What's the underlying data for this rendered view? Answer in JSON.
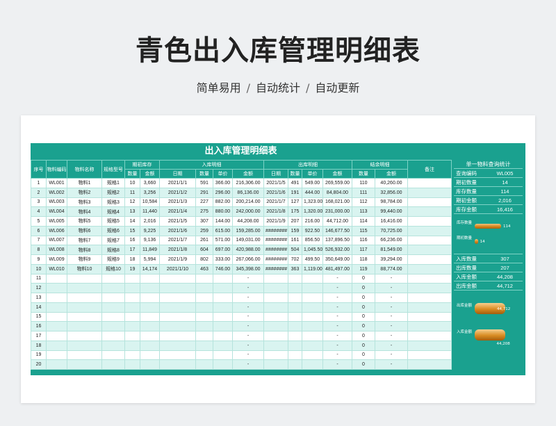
{
  "header": {
    "title": "青色出入库管理明细表",
    "subtitle_parts": [
      "简单易用",
      "自动统计",
      "自动更新"
    ],
    "sep": "/"
  },
  "sheet": {
    "title": "出入库管理明细表",
    "col_headers": {
      "no": "序号",
      "code": "物料编码",
      "name": "物料名称",
      "spec": "规格型号",
      "opening": "期初库存",
      "inbound": "入库明细",
      "outbound": "出库明细",
      "closing": "结余明细",
      "remark": "备注",
      "qty": "数量",
      "amount": "金额",
      "date": "日期",
      "price": "单价"
    },
    "rows": [
      {
        "no": "1",
        "code": "WL001",
        "name": "物料1",
        "spec": "规格1",
        "o_qty": "10",
        "o_amt": "3,660",
        "i_date": "2021/1/1",
        "i_qty": "591",
        "i_price": "366.00",
        "i_amt": "216,306.00",
        "x_date": "2021/1/5",
        "x_qty": "491",
        "x_price": "549.00",
        "x_amt": "269,559.00",
        "c_qty": "110",
        "c_amt": "40,260.00"
      },
      {
        "no": "2",
        "code": "WL002",
        "name": "物料2",
        "spec": "规格2",
        "o_qty": "11",
        "o_amt": "3,256",
        "i_date": "2021/1/2",
        "i_qty": "291",
        "i_price": "296.00",
        "i_amt": "86,136.00",
        "x_date": "2021/1/6",
        "x_qty": "191",
        "x_price": "444.00",
        "x_amt": "84,804.00",
        "c_qty": "111",
        "c_amt": "32,856.00"
      },
      {
        "no": "3",
        "code": "WL003",
        "name": "物料3",
        "spec": "规格3",
        "o_qty": "12",
        "o_amt": "10,584",
        "i_date": "2021/1/3",
        "i_qty": "227",
        "i_price": "882.00",
        "i_amt": "200,214.00",
        "x_date": "2021/1/7",
        "x_qty": "127",
        "x_price": "1,323.00",
        "x_amt": "168,021.00",
        "c_qty": "112",
        "c_amt": "98,784.00"
      },
      {
        "no": "4",
        "code": "WL004",
        "name": "物料4",
        "spec": "规格4",
        "o_qty": "13",
        "o_amt": "11,440",
        "i_date": "2021/1/4",
        "i_qty": "275",
        "i_price": "880.00",
        "i_amt": "242,000.00",
        "x_date": "2021/1/8",
        "x_qty": "175",
        "x_price": "1,320.00",
        "x_amt": "231,000.00",
        "c_qty": "113",
        "c_amt": "99,440.00"
      },
      {
        "no": "5",
        "code": "WL005",
        "name": "物料5",
        "spec": "规格5",
        "o_qty": "14",
        "o_amt": "2,016",
        "i_date": "2021/1/5",
        "i_qty": "307",
        "i_price": "144.00",
        "i_amt": "44,208.00",
        "x_date": "2021/1/9",
        "x_qty": "207",
        "x_price": "216.00",
        "x_amt": "44,712.00",
        "c_qty": "114",
        "c_amt": "16,416.00"
      },
      {
        "no": "6",
        "code": "WL006",
        "name": "物料6",
        "spec": "规格6",
        "o_qty": "15",
        "o_amt": "9,225",
        "i_date": "2021/1/6",
        "i_qty": "259",
        "i_price": "615.00",
        "i_amt": "159,285.00",
        "x_date": "########",
        "x_qty": "159",
        "x_price": "922.50",
        "x_amt": "146,677.50",
        "c_qty": "115",
        "c_amt": "70,725.00"
      },
      {
        "no": "7",
        "code": "WL007",
        "name": "物料7",
        "spec": "规格7",
        "o_qty": "16",
        "o_amt": "9,136",
        "i_date": "2021/1/7",
        "i_qty": "261",
        "i_price": "571.00",
        "i_amt": "149,031.00",
        "x_date": "########",
        "x_qty": "161",
        "x_price": "856.50",
        "x_amt": "137,896.50",
        "c_qty": "116",
        "c_amt": "66,236.00"
      },
      {
        "no": "8",
        "code": "WL008",
        "name": "物料8",
        "spec": "规格8",
        "o_qty": "17",
        "o_amt": "11,849",
        "i_date": "2021/1/8",
        "i_qty": "604",
        "i_price": "697.00",
        "i_amt": "420,988.00",
        "x_date": "########",
        "x_qty": "504",
        "x_price": "1,045.50",
        "x_amt": "526,932.00",
        "c_qty": "117",
        "c_amt": "81,549.00"
      },
      {
        "no": "9",
        "code": "WL009",
        "name": "物料9",
        "spec": "规格9",
        "o_qty": "18",
        "o_amt": "5,994",
        "i_date": "2021/1/9",
        "i_qty": "802",
        "i_price": "333.00",
        "i_amt": "267,066.00",
        "x_date": "########",
        "x_qty": "702",
        "x_price": "499.50",
        "x_amt": "350,649.00",
        "c_qty": "118",
        "c_amt": "39,294.00"
      },
      {
        "no": "10",
        "code": "WL010",
        "name": "物料10",
        "spec": "规格10",
        "o_qty": "19",
        "o_amt": "14,174",
        "i_date": "2021/1/10",
        "i_qty": "463",
        "i_price": "746.00",
        "i_amt": "345,398.00",
        "x_date": "########",
        "x_qty": "363",
        "x_price": "1,119.00",
        "x_amt": "481,497.00",
        "c_qty": "119",
        "c_amt": "88,774.00"
      },
      {
        "no": "11",
        "i_amt": "-",
        "x_amt": "-",
        "c_qty": "0",
        "c_amt": "-"
      },
      {
        "no": "12",
        "i_amt": "-",
        "x_amt": "-",
        "c_qty": "0",
        "c_amt": "-"
      },
      {
        "no": "13",
        "i_amt": "-",
        "x_amt": "-",
        "c_qty": "0",
        "c_amt": "-"
      },
      {
        "no": "14",
        "i_amt": "-",
        "x_amt": "-",
        "c_qty": "0",
        "c_amt": "-"
      },
      {
        "no": "15",
        "i_amt": "-",
        "x_amt": "-",
        "c_qty": "0",
        "c_amt": "-"
      },
      {
        "no": "16",
        "i_amt": "-",
        "x_amt": "-",
        "c_qty": "0",
        "c_amt": "-"
      },
      {
        "no": "17",
        "i_amt": "-",
        "x_amt": "-",
        "c_qty": "0",
        "c_amt": "-"
      },
      {
        "no": "18",
        "i_amt": "-",
        "x_amt": "-",
        "c_qty": "0",
        "c_amt": "-"
      },
      {
        "no": "19",
        "i_amt": "-",
        "x_amt": "-",
        "c_qty": "0",
        "c_amt": "-"
      },
      {
        "no": "20",
        "i_amt": "-",
        "x_amt": "-",
        "c_qty": "0",
        "c_amt": "-"
      }
    ]
  },
  "stats": {
    "title": "单一物料查询统计",
    "query": [
      {
        "label": "查询编码",
        "value": "WL005"
      },
      {
        "label": "期初数量",
        "value": "14"
      },
      {
        "label": "库存数量",
        "value": "114"
      },
      {
        "label": "期初金额",
        "value": "2,016"
      },
      {
        "label": "库存金额",
        "value": "16,416"
      }
    ],
    "mini_chart": {
      "bars": [
        {
          "label": "库存数量",
          "value": 114,
          "value_label": "114"
        },
        {
          "label": "期初数量",
          "value": 14,
          "value_label": "14"
        }
      ]
    },
    "totals": [
      {
        "label": "入库数量",
        "value": "307"
      },
      {
        "label": "出库数量",
        "value": "207"
      },
      {
        "label": "入库金额",
        "value": "44,208"
      },
      {
        "label": "出库金额",
        "value": "44,712"
      }
    ],
    "amount_chart": {
      "bars": [
        {
          "label": "出库金额",
          "value": 44712,
          "value_label": "44,712"
        },
        {
          "label": "入库金额",
          "value": 44208,
          "value_label": "44,208"
        }
      ]
    }
  },
  "colors": {
    "teal": "#1aa18f",
    "row_alt": "#d9f4f0",
    "bar": "#d4871f"
  }
}
